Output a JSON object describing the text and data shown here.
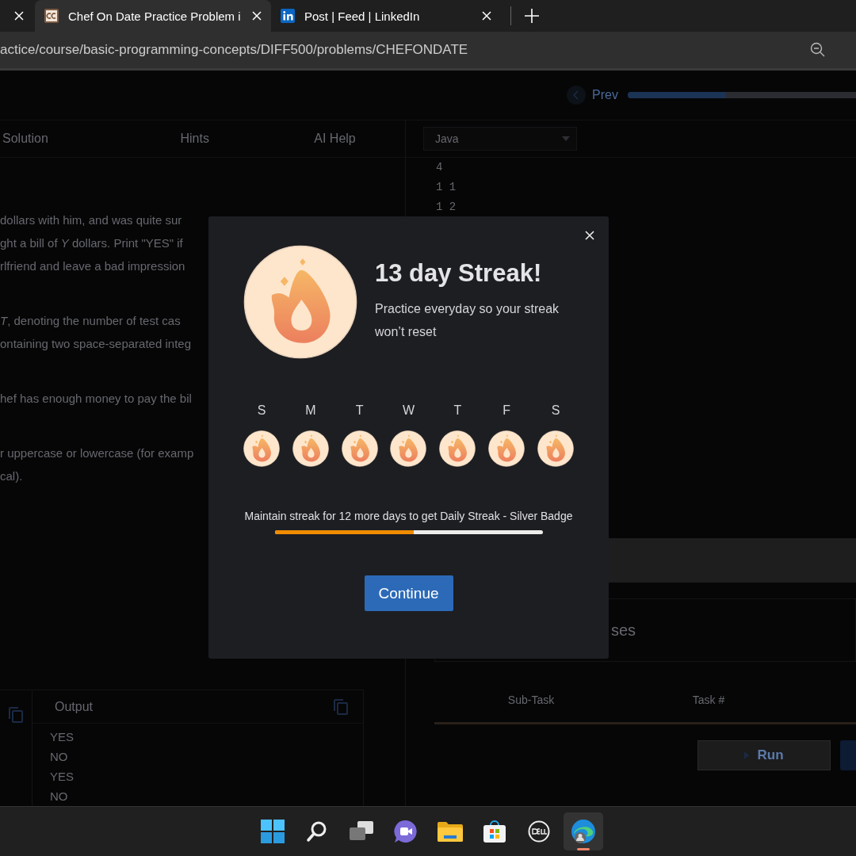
{
  "browser": {
    "tabs": [
      {
        "title": "Chef On Date Practice Problem i",
        "selected": true
      },
      {
        "title": "Post | Feed | LinkedIn",
        "selected": false
      }
    ],
    "address": "actice/course/basic-programming-concepts/DIFF500/problems/CHEFONDATE"
  },
  "page": {
    "prev_label": "Prev",
    "progress": {
      "level": 0.43
    },
    "tabs": [
      "Solution",
      "Hints",
      "AI Help"
    ],
    "language": "Java",
    "statement": [
      [
        "dollars with him, and was quite sur",
        "ght a bill of *Y* dollars. Print \"YES\" if",
        "rlfriend and leave a bad impression"
      ],
      [
        "*T*, denoting the number of test cas",
        "ontaining two space-separated integ"
      ],
      [
        "hef has enough money to pay the bil"
      ],
      [
        "r uppercase or lowercase (for examp",
        "cal)."
      ]
    ],
    "code_lines": [
      "4",
      "1 1",
      "1 2"
    ],
    "output": {
      "title": "Output",
      "lines": [
        "YES",
        "NO",
        "YES",
        "NO"
      ]
    },
    "cases_title": "ses",
    "table_columns": [
      "Sub-Task",
      "Task #"
    ],
    "run_label": "Run"
  },
  "modal": {
    "title": "13 day Streak!",
    "subtitle": "Practice everyday so your streak won’t reset",
    "days": [
      "S",
      "M",
      "T",
      "W",
      "T",
      "F",
      "S"
    ],
    "message": "Maintain streak for 12 more days to get Daily Streak - Silver Badge",
    "progress": {
      "level": 0.52
    },
    "button": "Continue"
  },
  "taskbar": [
    {
      "kind": "start",
      "selected": false
    },
    {
      "kind": "search",
      "selected": false
    },
    {
      "kind": "taskview",
      "selected": false
    },
    {
      "kind": "chat",
      "selected": false
    },
    {
      "kind": "folder",
      "selected": false
    },
    {
      "kind": "store",
      "selected": false
    },
    {
      "kind": "dell",
      "selected": false
    },
    {
      "kind": "edge",
      "selected": true
    }
  ]
}
